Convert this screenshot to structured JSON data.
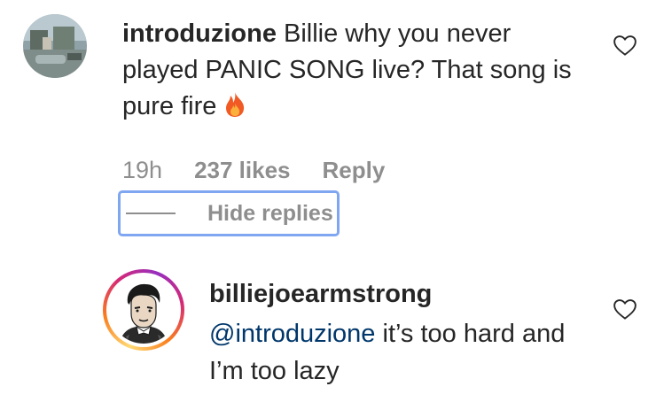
{
  "comment": {
    "username": "introduzione",
    "text": "Billie why you never played PANIC SONG live? That song is pure fire",
    "emoji": "🔥",
    "time": "19h",
    "likes": "237 likes",
    "reply_label": "Reply",
    "hide_replies_label": "Hide replies"
  },
  "reply": {
    "username": "billiejoearmstrong",
    "mention": "@introduzione",
    "text": " it’s too hard and I’m too lazy"
  },
  "icons": {
    "like": "heart-outline-icon",
    "fire": "fire-emoji"
  }
}
